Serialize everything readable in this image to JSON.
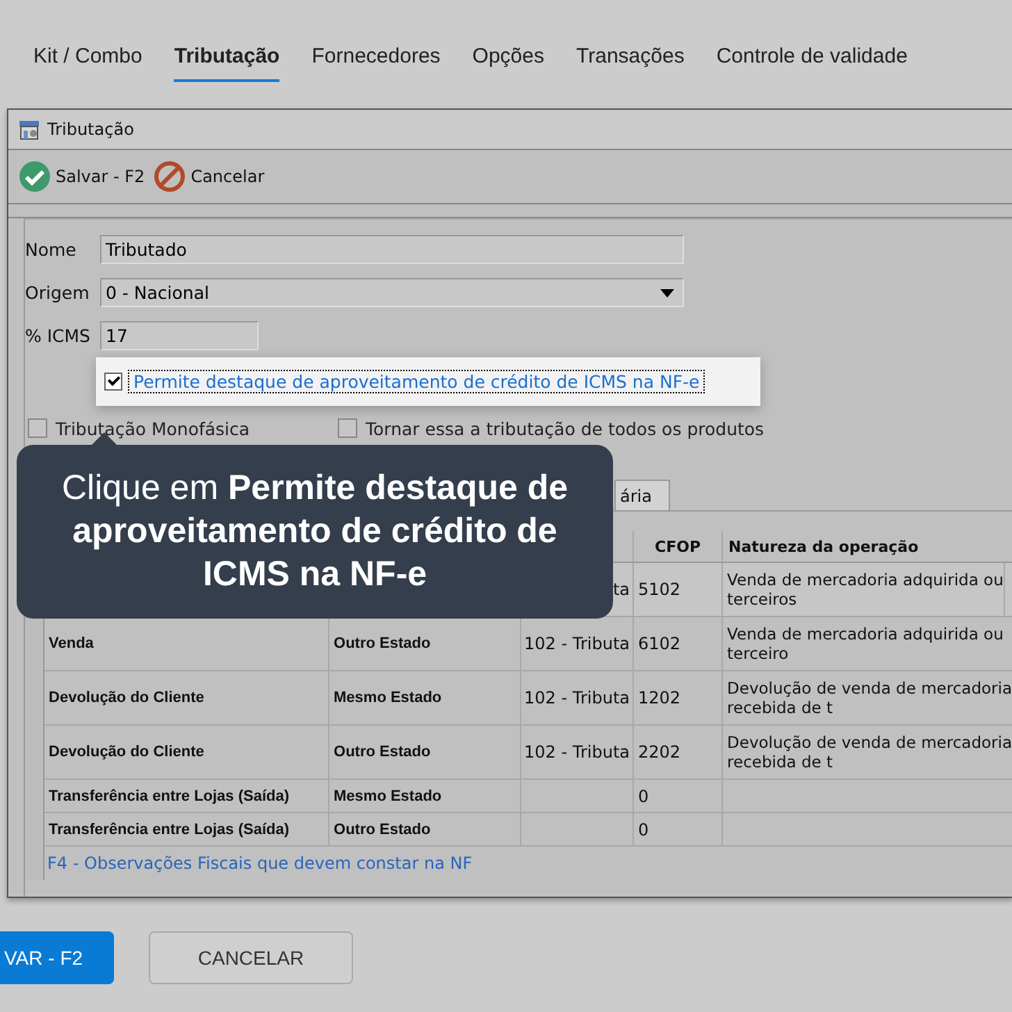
{
  "top_tabs": [
    {
      "label": "Kit / Combo",
      "selected": false
    },
    {
      "label": "Tributação",
      "selected": true
    },
    {
      "label": "Fornecedores",
      "selected": false
    },
    {
      "label": "Opções",
      "selected": false
    },
    {
      "label": "Transações",
      "selected": false
    },
    {
      "label": "Controle de validade",
      "selected": false
    }
  ],
  "dialog": {
    "title": "Tributação",
    "toolbar": [
      {
        "kind": "save",
        "label": "Salvar - F2"
      },
      {
        "kind": "cancel",
        "label": "Cancelar"
      }
    ],
    "fields": [
      {
        "kind": "text",
        "label": "Nome",
        "value": "Tributado"
      },
      {
        "kind": "select",
        "label": "Origem",
        "value": "0 - Nacional"
      },
      {
        "kind": "short",
        "label": "% ICMS",
        "value": "17"
      }
    ],
    "highlighted_option": {
      "label": "Permite destaque de aproveitamento de crédito de ICMS na NF-e",
      "checked": true
    },
    "options": [
      {
        "label": "Tributação Monofásica",
        "checked": false
      },
      {
        "label": "Tornar essa a tributação de todos os produtos",
        "checked": false
      }
    ],
    "inner_tabs": [
      {
        "label": "ária",
        "selected": true
      }
    ],
    "table": {
      "columns": [
        "CFOP",
        "Natureza da operação"
      ],
      "rows": [
        {
          "column_3": "ta",
          "cfop": "5102",
          "natureza": [
            "Venda de mercadoria adquirida ou",
            "terceiros"
          ],
          "selected": true
        },
        {
          "column_1": "Venda",
          "column_2": "Outro Estado",
          "column_3": "102 - Tributa",
          "cfop": "6102",
          "natureza": [
            "Venda de mercadoria adquirida ou",
            "terceiro"
          ],
          "selected": false
        },
        {
          "column_1": "Devolução do Cliente",
          "column_2": "Mesmo Estado",
          "column_3": "102 - Tributa",
          "cfop": "1202",
          "natureza": [
            "Devolução de venda de mercadoria",
            "recebida de t"
          ],
          "selected": false
        },
        {
          "column_1": "Devolução do Cliente",
          "column_2": "Outro Estado",
          "column_3": "102 - Tributa",
          "cfop": "2202",
          "natureza": [
            "Devolução de venda de mercadoria",
            "recebida de t"
          ],
          "selected": false
        },
        {
          "column_1": "Transferência entre Lojas (Saída)",
          "column_2": "Mesmo Estado",
          "cfop": "0",
          "selected": false
        },
        {
          "column_1": "Transferência entre Lojas (Saída)",
          "column_2": "Outro Estado",
          "cfop": "0",
          "selected": false
        }
      ]
    },
    "footer_link": "F4 - Observações Fiscais que devem constar na NF"
  },
  "tooltip": "Clique em **Permite destaque de aproveitamento de crédito de ICMS na NF-e**",
  "bottom_buttons": [
    {
      "kind": "primary",
      "label": "VAR - F2"
    },
    {
      "kind": "secondary",
      "label": "CANCELAR"
    }
  ]
}
